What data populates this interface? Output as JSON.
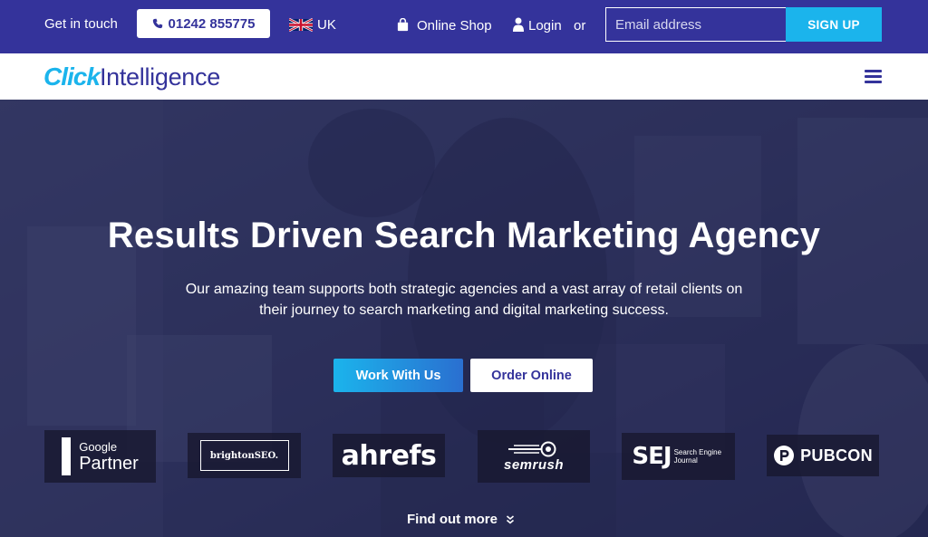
{
  "topbar": {
    "contact_label": "Get in touch",
    "phone": "01242 855775",
    "region": "UK",
    "shop_label": "Online Shop",
    "login_label": "Login",
    "or_label": "or",
    "email_placeholder": "Email address",
    "signup_label": "SIGN UP"
  },
  "header": {
    "logo_part1": "Click",
    "logo_part2": "Intelligence"
  },
  "hero": {
    "title": "Results Driven Search Marketing Agency",
    "subtitle_line1": "Our amazing team supports both strategic agencies and a vast array of retail clients on",
    "subtitle_line2": "their journey to search marketing and digital marketing success.",
    "primary_button": "Work With Us",
    "secondary_button": "Order Online",
    "find_more": "Find out more"
  },
  "partners": {
    "google_line1": "Google",
    "google_line2": "Partner",
    "brighton": "brightonSEO.",
    "ahrefs": "ahrefs",
    "semrush": "semrush",
    "sej_big": "SEJ",
    "sej_small": "Search Engine Journal",
    "pubcon": "PUBCON"
  },
  "colors": {
    "brand_navy": "#34339b",
    "brand_cyan": "#1bb4ec"
  }
}
